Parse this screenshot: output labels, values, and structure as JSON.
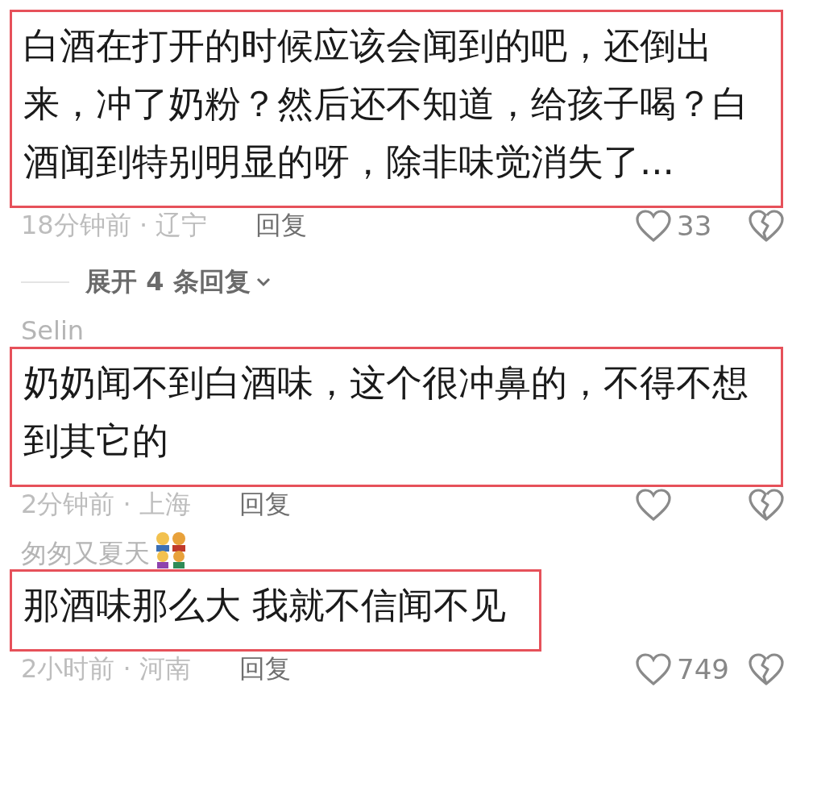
{
  "comments": [
    {
      "text": "白酒在打开的时候应该会闻到的吧，还倒出来，冲了奶粉？然后还不知道，给孩子喝？白酒闻到特别明显的呀，除非味觉消失了...",
      "highlighted": true,
      "meta": "18分钟前 · 辽宁",
      "reply": "回复",
      "likes": "33",
      "expand": "展开 4 条回复"
    },
    {
      "username": "Selin",
      "text": "奶奶闻不到白酒味，这个很冲鼻的，不得不想到其它的",
      "highlighted": true,
      "meta": "2分钟前 · 上海",
      "reply": "回复"
    },
    {
      "username": "匆匆又夏天",
      "family_emoji": true,
      "text": "那酒味那么大 我就不信闻不见",
      "highlighted": true,
      "meta": "2小时前 · 河南",
      "reply": "回复",
      "likes": "749"
    }
  ]
}
